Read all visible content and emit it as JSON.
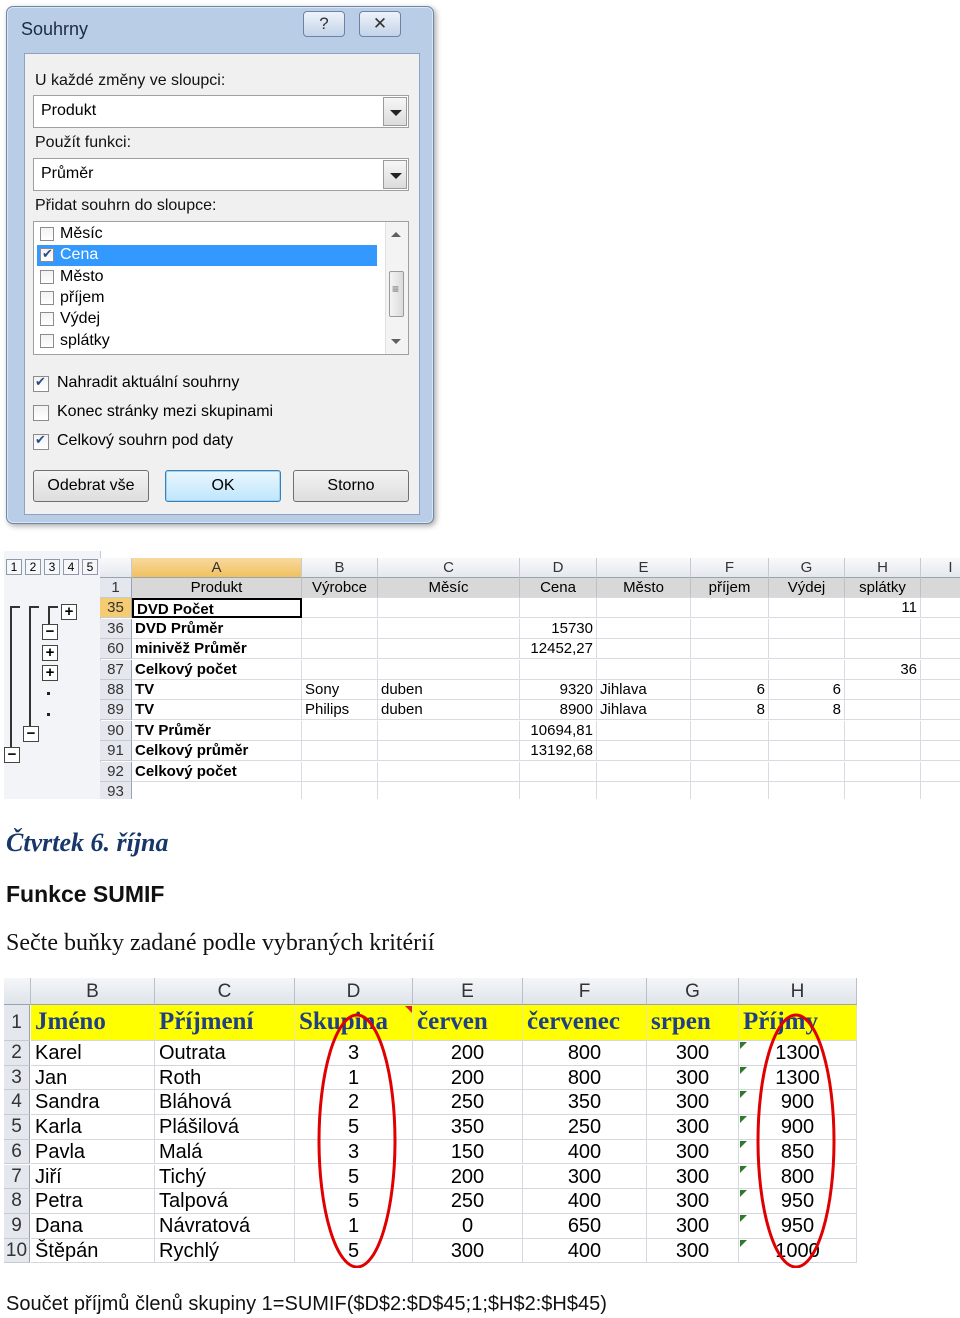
{
  "dialog": {
    "title": "Souhrny",
    "help_glyph": "?",
    "close_glyph": "✕",
    "label_change_in": "U každé změny ve sloupci:",
    "change_in_value": "Produkt",
    "label_function": "Použít funkci:",
    "function_value": "Průměr",
    "label_add_to": "Přidat souhrn do sloupce:",
    "columns": [
      {
        "label": "Měsíc",
        "checked": false,
        "selected": false
      },
      {
        "label": "Cena",
        "checked": true,
        "selected": true
      },
      {
        "label": "Město",
        "checked": false,
        "selected": false
      },
      {
        "label": "příjem",
        "checked": false,
        "selected": false
      },
      {
        "label": "Výdej",
        "checked": false,
        "selected": false
      },
      {
        "label": "splátky",
        "checked": false,
        "selected": false
      }
    ],
    "options": [
      {
        "label": "Nahradit aktuální souhrny",
        "checked": true
      },
      {
        "label": "Konec stránky mezi skupinami",
        "checked": false
      },
      {
        "label": "Celkový souhrn pod daty",
        "checked": true
      }
    ],
    "btn_remove_all": "Odebrat vše",
    "btn_ok": "OK",
    "btn_cancel": "Storno"
  },
  "sheet1": {
    "outline_levels": [
      "1",
      "2",
      "3",
      "4",
      "5"
    ],
    "columns": [
      "A",
      "B",
      "C",
      "D",
      "E",
      "F",
      "G",
      "H",
      "I"
    ],
    "header_row": {
      "num": "1",
      "cells": [
        "Produkt",
        "Výrobce",
        "Měsíc",
        "Cena",
        "Město",
        "příjem",
        "Výdej",
        "splátky"
      ]
    },
    "rows": [
      {
        "num": "35",
        "A": "DVD Počet",
        "B": "",
        "C": "",
        "D": "",
        "E": "",
        "F": "",
        "G": "",
        "H": "11"
      },
      {
        "num": "36",
        "A": "DVD Průměr",
        "B": "",
        "C": "",
        "D": "15730",
        "E": "",
        "F": "",
        "G": "",
        "H": ""
      },
      {
        "num": "60",
        "A": "minivěž Průměr",
        "B": "",
        "C": "",
        "D": "12452,27",
        "E": "",
        "F": "",
        "G": "",
        "H": ""
      },
      {
        "num": "87",
        "A": "Celkový počet",
        "B": "",
        "C": "",
        "D": "",
        "E": "",
        "F": "",
        "G": "",
        "H": "36"
      },
      {
        "num": "88",
        "A": "TV",
        "B": "Sony",
        "C": "duben",
        "D": "9320",
        "E": "Jihlava",
        "F": "6",
        "G": "6",
        "H": ""
      },
      {
        "num": "89",
        "A": "TV",
        "B": "Philips",
        "C": "duben",
        "D": "8900",
        "E": "Jihlava",
        "F": "8",
        "G": "8",
        "H": ""
      },
      {
        "num": "90",
        "A": "TV Průměr",
        "B": "",
        "C": "",
        "D": "10694,81",
        "E": "",
        "F": "",
        "G": "",
        "H": ""
      },
      {
        "num": "91",
        "A": "Celkový průměr",
        "B": "",
        "C": "",
        "D": "13192,68",
        "E": "",
        "F": "",
        "G": "",
        "H": ""
      },
      {
        "num": "92",
        "A": "Celkový počet",
        "B": "",
        "C": "",
        "D": "",
        "E": "",
        "F": "",
        "G": "",
        "H": ""
      },
      {
        "num": "93",
        "A": "",
        "B": "",
        "C": "",
        "D": "",
        "E": "",
        "F": "",
        "G": "",
        "H": ""
      }
    ]
  },
  "doc": {
    "date_heading": "Čtvrtek 6. října",
    "function_heading": "Funkce SUMIF",
    "description": "Sečte buňky zadané podle vybraných kritérií",
    "formula_line": "Součet příjmů členů skupiny 1=SUMIF($D$2:$D$45;1;$H$2:$H$45)"
  },
  "sheet2": {
    "columns": [
      "B",
      "C",
      "D",
      "E",
      "F",
      "G",
      "H"
    ],
    "header": {
      "num": "1",
      "cells": [
        "Jméno",
        "Příjmení",
        "Skupina",
        "červen",
        "červenec",
        "srpen",
        "Příjmy"
      ]
    },
    "rows": [
      {
        "num": "2",
        "cells": [
          "Karel",
          "Outrata",
          "3",
          "200",
          "800",
          "300",
          "1300"
        ]
      },
      {
        "num": "3",
        "cells": [
          "Jan",
          "Roth",
          "1",
          "200",
          "800",
          "300",
          "1300"
        ]
      },
      {
        "num": "4",
        "cells": [
          "Sandra",
          "Bláhová",
          "2",
          "250",
          "350",
          "300",
          "900"
        ]
      },
      {
        "num": "5",
        "cells": [
          "Karla",
          "Plášilová",
          "5",
          "350",
          "250",
          "300",
          "900"
        ]
      },
      {
        "num": "6",
        "cells": [
          "Pavla",
          "Malá",
          "3",
          "150",
          "400",
          "300",
          "850"
        ]
      },
      {
        "num": "7",
        "cells": [
          "Jiří",
          "Tichý",
          "5",
          "200",
          "300",
          "300",
          "800"
        ]
      },
      {
        "num": "8",
        "cells": [
          "Petra",
          "Talpová",
          "5",
          "250",
          "400",
          "300",
          "950"
        ]
      },
      {
        "num": "9",
        "cells": [
          "Dana",
          "Návratová",
          "1",
          "0",
          "650",
          "300",
          "950"
        ]
      },
      {
        "num": "10",
        "cells": [
          "Štěpán",
          "Rychlý",
          "5",
          "300",
          "400",
          "300",
          "1000"
        ]
      }
    ],
    "highlight_color": "#ffff00",
    "annotation_color": "#e00000"
  }
}
